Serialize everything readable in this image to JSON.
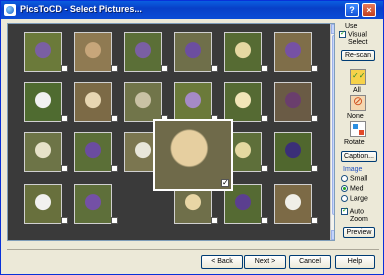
{
  "window": {
    "title": "PicsToCD - Select Pictures...",
    "icon": "app-icon"
  },
  "titlebar_buttons": {
    "help": "?",
    "close": "×"
  },
  "options": {
    "visual_select": {
      "line1": "Use",
      "line2": "Visual",
      "line3": "Select",
      "checked": true
    },
    "rescan_label": "Re-scan",
    "all_label": "All",
    "none_label": "None",
    "rotate_label": "Rotate",
    "caption_label": "Caption...",
    "image_group_label": "Image",
    "sizes": [
      {
        "label": "Small",
        "selected": false
      },
      {
        "label": "Med",
        "selected": true
      },
      {
        "label": "Large",
        "selected": false
      }
    ],
    "auto_zoom": {
      "line1": "Auto",
      "line2": "Zoom",
      "checked": true
    },
    "preview_label": "Preview"
  },
  "footer": {
    "back_label": "< Back",
    "next_label": "Next >",
    "cancel_label": "Cancel",
    "help_label": "Help"
  },
  "thumbnails": [
    {
      "color": "#6b7a3a",
      "flower": "#7a5fa3"
    },
    {
      "color": "#8f7a52",
      "flower": "#c7a67a"
    },
    {
      "color": "#5b6f37",
      "flower": "#7a5fa3"
    },
    {
      "color": "#6f6f4a",
      "flower": "#6c4ea0"
    },
    {
      "color": "#566b33",
      "flower": "#e6d8a2"
    },
    {
      "color": "#7f6e49",
      "flower": "#7651a4"
    },
    {
      "color": "#4f6b30",
      "flower": "#f1f1f1"
    },
    {
      "color": "#7c6a46",
      "flower": "#e7d6b2"
    },
    {
      "color": "#71754a",
      "flower": "#c9c1a4"
    },
    {
      "color": "#6b7a3a",
      "flower": "#a58ac7"
    },
    {
      "color": "#556a33",
      "flower": "#f2e5b8"
    },
    {
      "color": "#6a5b45",
      "flower": "#6a3e6d"
    },
    {
      "color": "#6d7447",
      "flower": "#e7e2c9"
    },
    {
      "color": "#5b6f37",
      "flower": "#6b4ca0"
    },
    {
      "color": "#7b7650",
      "flower": "#e8e6da"
    },
    {
      "color": "#5e6f3a",
      "flower": "#e4d8a0"
    },
    {
      "color": "#50672e",
      "flower": "#3b2f78"
    },
    {
      "color": "#68703d",
      "flower": "#f1f1ef"
    },
    {
      "color": "#5e6f3a",
      "flower": "#7450a6"
    },
    {
      "color": "#6f6f4a",
      "flower": "#e8d6a5"
    },
    {
      "color": "#556a33",
      "flower": "#5b3f8f"
    },
    {
      "color": "#7c6a46",
      "flower": "#f0efe8"
    }
  ],
  "featured_thumbnail": {
    "color": "#6f6a4a",
    "flower": "#e6cfa0",
    "checked": true
  }
}
